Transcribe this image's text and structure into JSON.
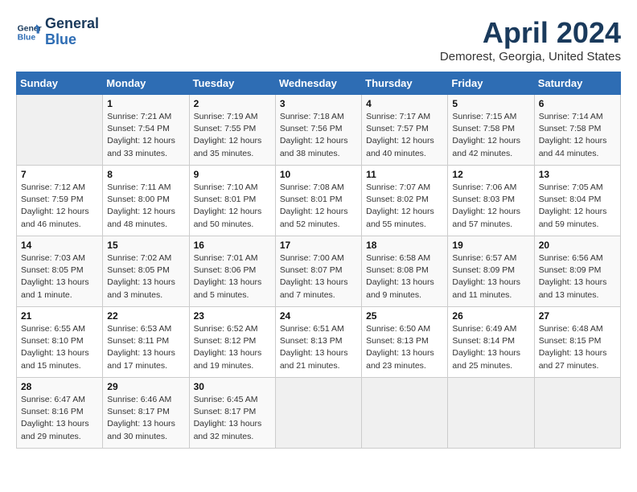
{
  "header": {
    "logo_line1": "General",
    "logo_line2": "Blue",
    "title": "April 2024",
    "subtitle": "Demorest, Georgia, United States"
  },
  "calendar": {
    "days_of_week": [
      "Sunday",
      "Monday",
      "Tuesday",
      "Wednesday",
      "Thursday",
      "Friday",
      "Saturday"
    ],
    "weeks": [
      [
        {
          "day": "",
          "info": ""
        },
        {
          "day": "1",
          "info": "Sunrise: 7:21 AM\nSunset: 7:54 PM\nDaylight: 12 hours\nand 33 minutes."
        },
        {
          "day": "2",
          "info": "Sunrise: 7:19 AM\nSunset: 7:55 PM\nDaylight: 12 hours\nand 35 minutes."
        },
        {
          "day": "3",
          "info": "Sunrise: 7:18 AM\nSunset: 7:56 PM\nDaylight: 12 hours\nand 38 minutes."
        },
        {
          "day": "4",
          "info": "Sunrise: 7:17 AM\nSunset: 7:57 PM\nDaylight: 12 hours\nand 40 minutes."
        },
        {
          "day": "5",
          "info": "Sunrise: 7:15 AM\nSunset: 7:58 PM\nDaylight: 12 hours\nand 42 minutes."
        },
        {
          "day": "6",
          "info": "Sunrise: 7:14 AM\nSunset: 7:58 PM\nDaylight: 12 hours\nand 44 minutes."
        }
      ],
      [
        {
          "day": "7",
          "info": "Sunrise: 7:12 AM\nSunset: 7:59 PM\nDaylight: 12 hours\nand 46 minutes."
        },
        {
          "day": "8",
          "info": "Sunrise: 7:11 AM\nSunset: 8:00 PM\nDaylight: 12 hours\nand 48 minutes."
        },
        {
          "day": "9",
          "info": "Sunrise: 7:10 AM\nSunset: 8:01 PM\nDaylight: 12 hours\nand 50 minutes."
        },
        {
          "day": "10",
          "info": "Sunrise: 7:08 AM\nSunset: 8:01 PM\nDaylight: 12 hours\nand 52 minutes."
        },
        {
          "day": "11",
          "info": "Sunrise: 7:07 AM\nSunset: 8:02 PM\nDaylight: 12 hours\nand 55 minutes."
        },
        {
          "day": "12",
          "info": "Sunrise: 7:06 AM\nSunset: 8:03 PM\nDaylight: 12 hours\nand 57 minutes."
        },
        {
          "day": "13",
          "info": "Sunrise: 7:05 AM\nSunset: 8:04 PM\nDaylight: 12 hours\nand 59 minutes."
        }
      ],
      [
        {
          "day": "14",
          "info": "Sunrise: 7:03 AM\nSunset: 8:05 PM\nDaylight: 13 hours\nand 1 minute."
        },
        {
          "day": "15",
          "info": "Sunrise: 7:02 AM\nSunset: 8:05 PM\nDaylight: 13 hours\nand 3 minutes."
        },
        {
          "day": "16",
          "info": "Sunrise: 7:01 AM\nSunset: 8:06 PM\nDaylight: 13 hours\nand 5 minutes."
        },
        {
          "day": "17",
          "info": "Sunrise: 7:00 AM\nSunset: 8:07 PM\nDaylight: 13 hours\nand 7 minutes."
        },
        {
          "day": "18",
          "info": "Sunrise: 6:58 AM\nSunset: 8:08 PM\nDaylight: 13 hours\nand 9 minutes."
        },
        {
          "day": "19",
          "info": "Sunrise: 6:57 AM\nSunset: 8:09 PM\nDaylight: 13 hours\nand 11 minutes."
        },
        {
          "day": "20",
          "info": "Sunrise: 6:56 AM\nSunset: 8:09 PM\nDaylight: 13 hours\nand 13 minutes."
        }
      ],
      [
        {
          "day": "21",
          "info": "Sunrise: 6:55 AM\nSunset: 8:10 PM\nDaylight: 13 hours\nand 15 minutes."
        },
        {
          "day": "22",
          "info": "Sunrise: 6:53 AM\nSunset: 8:11 PM\nDaylight: 13 hours\nand 17 minutes."
        },
        {
          "day": "23",
          "info": "Sunrise: 6:52 AM\nSunset: 8:12 PM\nDaylight: 13 hours\nand 19 minutes."
        },
        {
          "day": "24",
          "info": "Sunrise: 6:51 AM\nSunset: 8:13 PM\nDaylight: 13 hours\nand 21 minutes."
        },
        {
          "day": "25",
          "info": "Sunrise: 6:50 AM\nSunset: 8:13 PM\nDaylight: 13 hours\nand 23 minutes."
        },
        {
          "day": "26",
          "info": "Sunrise: 6:49 AM\nSunset: 8:14 PM\nDaylight: 13 hours\nand 25 minutes."
        },
        {
          "day": "27",
          "info": "Sunrise: 6:48 AM\nSunset: 8:15 PM\nDaylight: 13 hours\nand 27 minutes."
        }
      ],
      [
        {
          "day": "28",
          "info": "Sunrise: 6:47 AM\nSunset: 8:16 PM\nDaylight: 13 hours\nand 29 minutes."
        },
        {
          "day": "29",
          "info": "Sunrise: 6:46 AM\nSunset: 8:17 PM\nDaylight: 13 hours\nand 30 minutes."
        },
        {
          "day": "30",
          "info": "Sunrise: 6:45 AM\nSunset: 8:17 PM\nDaylight: 13 hours\nand 32 minutes."
        },
        {
          "day": "",
          "info": ""
        },
        {
          "day": "",
          "info": ""
        },
        {
          "day": "",
          "info": ""
        },
        {
          "day": "",
          "info": ""
        }
      ]
    ]
  }
}
